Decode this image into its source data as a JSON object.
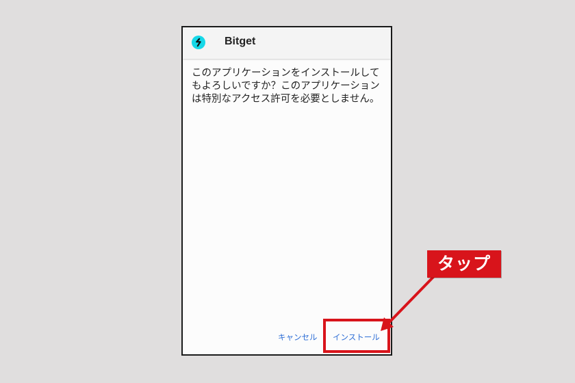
{
  "dialog": {
    "app_name": "Bitget",
    "app_icon": "bitget-logo-icon",
    "message": "このアプリケーションをインストールしてもよろしいですか？このアプリケーションは特別なアクセス許可を必要としません。",
    "cancel_label": "キャンセル",
    "install_label": "インストール"
  },
  "annotation": {
    "callout_text": "タップ",
    "color": "#d8141b"
  },
  "colors": {
    "background": "#e0dede",
    "button_text": "#2f6fd6",
    "icon_cyan": "#16d8e8"
  }
}
